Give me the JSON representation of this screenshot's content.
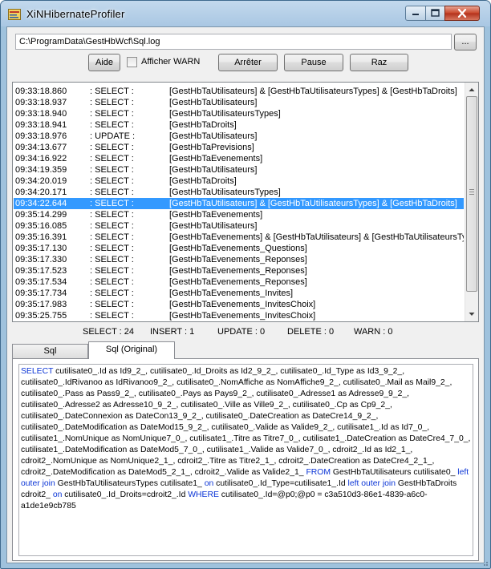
{
  "window": {
    "title": "XiNHibernateProfiler"
  },
  "toolbar": {
    "path": "C:\\ProgramData\\GestHbWcf\\Sql.log",
    "browse_label": "...",
    "help_label": "Aide",
    "warn_label": "Afficher WARN",
    "warn_checked": false,
    "stop_label": "Arrêter",
    "pause_label": "Pause",
    "reset_label": "Raz"
  },
  "log": {
    "selected_index": 9,
    "rows": [
      {
        "time": "09:33:18.860",
        "type": ": SELECT :",
        "tables": "[GestHbTaUtilisateurs] & [GestHbTaUtilisateursTypes] & [GestHbTaDroits]"
      },
      {
        "time": "09:33:18.937",
        "type": ": SELECT :",
        "tables": "[GestHbTaUtilisateurs]"
      },
      {
        "time": "09:33:18.940",
        "type": ": SELECT :",
        "tables": "[GestHbTaUtilisateursTypes]"
      },
      {
        "time": "09:33:18.941",
        "type": ": SELECT :",
        "tables": "[GestHbTaDroits]"
      },
      {
        "time": "09:33:18.976",
        "type": ": UPDATE :",
        "tables": "[GestHbTaUtilisateurs]"
      },
      {
        "time": "09:34:13.677",
        "type": ": SELECT :",
        "tables": "[GestHbTaPrevisions]"
      },
      {
        "time": "09:34:16.922",
        "type": ": SELECT :",
        "tables": "[GestHbTaEvenements]"
      },
      {
        "time": "09:34:19.359",
        "type": ": SELECT :",
        "tables": "[GestHbTaUtilisateurs]"
      },
      {
        "time": "09:34:20.019",
        "type": ": SELECT :",
        "tables": "[GestHbTaDroits]"
      },
      {
        "time": "09:34:20.171",
        "type": ": SELECT :",
        "tables": "[GestHbTaUtilisateursTypes]"
      },
      {
        "time": "09:34:22.644",
        "type": ": SELECT :",
        "tables": "[GestHbTaUtilisateurs] & [GestHbTaUtilisateursTypes] & [GestHbTaDroits]"
      },
      {
        "time": "09:35:14.299",
        "type": ": SELECT :",
        "tables": "[GestHbTaEvenements]"
      },
      {
        "time": "09:35:16.085",
        "type": ": SELECT :",
        "tables": "[GestHbTaUtilisateurs]"
      },
      {
        "time": "09:35:16.391",
        "type": ": SELECT :",
        "tables": "[GestHbTaEvenements] & [GestHbTaUtilisateurs] & [GestHbTaUtilisateursTypes]"
      },
      {
        "time": "09:35:17.130",
        "type": ": SELECT :",
        "tables": "[GestHbTaEvenements_Questions]"
      },
      {
        "time": "09:35:17.330",
        "type": ": SELECT :",
        "tables": "[GestHbTaEvenements_Reponses]"
      },
      {
        "time": "09:35:17.523",
        "type": ": SELECT :",
        "tables": "[GestHbTaEvenements_Reponses]"
      },
      {
        "time": "09:35:17.534",
        "type": ": SELECT :",
        "tables": "[GestHbTaEvenements_Reponses]"
      },
      {
        "time": "09:35:17.734",
        "type": ": SELECT :",
        "tables": "[GestHbTaEvenements_Invites]"
      },
      {
        "time": "09:35:17.983",
        "type": ": SELECT :",
        "tables": "[GestHbTaEvenements_InvitesChoix]"
      },
      {
        "time": "09:35:25.755",
        "type": ": SELECT :",
        "tables": "[GestHbTaEvenements_InvitesChoix]"
      }
    ]
  },
  "stats": {
    "select": "SELECT :  24",
    "insert": "INSERT :   1",
    "update": "UPDATE :   0",
    "delete": "DELETE :   0",
    "warn": "WARN :  0"
  },
  "tabs": [
    {
      "label": "Sql",
      "active": false
    },
    {
      "label": "Sql (Original)",
      "active": true
    }
  ],
  "sql_original": [
    {
      "t": "SELECT",
      "kw": true
    },
    {
      "t": " cutilisate0_.Id as Id9_2_, cutilisate0_.Id_Droits as Id2_9_2_, cutilisate0_.Id_Type as Id3_9_2_, cutilisate0_.IdRivanoo as IdRivanoo9_2_, cutilisate0_.NomAffiche as NomAffiche9_2_, cutilisate0_.Mail as Mail9_2_, cutilisate0_.Pass as Pass9_2_, cutilisate0_.Pays as Pays9_2_, cutilisate0_.Adresse1 as Adresse9_9_2_, cutilisate0_.Adresse2 as Adresse10_9_2_, cutilisate0_.Ville as Ville9_2_, cutilisate0_.Cp as Cp9_2_, cutilisate0_.DateConnexion as DateCon13_9_2_, cutilisate0_.DateCreation as DateCre14_9_2_, cutilisate0_.DateModification as DateMod15_9_2_, cutilisate0_.Valide as Valide9_2_, cutilisate1_.Id as Id7_0_, cutilisate1_.NomUnique as NomUnique7_0_, cutilisate1_.Titre as Titre7_0_, cutilisate1_.DateCreation as DateCre4_7_0_, cutilisate1_.DateModification as DateMod5_7_0_, cutilisate1_.Valide as Valide7_0_, cdroit2_.Id as Id2_1_, cdroit2_.NomUnique as NomUnique2_1_, cdroit2_.Titre as Titre2_1_, cdroit2_.DateCreation as DateCre4_2_1_, cdroit2_.DateModification as DateMod5_2_1_, cdroit2_.Valide as Valide2_1_ ",
      "kw": false
    },
    {
      "t": "FROM",
      "kw": true
    },
    {
      "t": " GestHbTaUtilisateurs cutilisate0_ ",
      "kw": false
    },
    {
      "t": "left outer join",
      "kw": true
    },
    {
      "t": " GestHbTaUtilisateursTypes cutilisate1_ ",
      "kw": false
    },
    {
      "t": "on",
      "kw": true
    },
    {
      "t": " cutilisate0_.Id_Type=cutilisate1_.Id ",
      "kw": false
    },
    {
      "t": "left outer join",
      "kw": true
    },
    {
      "t": " GestHbTaDroits cdroit2_ ",
      "kw": false
    },
    {
      "t": "on",
      "kw": true
    },
    {
      "t": " cutilisate0_.Id_Droits=cdroit2_.Id ",
      "kw": false
    },
    {
      "t": "WHERE",
      "kw": true
    },
    {
      "t": " cutilisate0_.Id=@p0;@p0 = c3a510d3-86e1-4839-a6c0-a1de1e9cb785",
      "kw": false
    }
  ]
}
